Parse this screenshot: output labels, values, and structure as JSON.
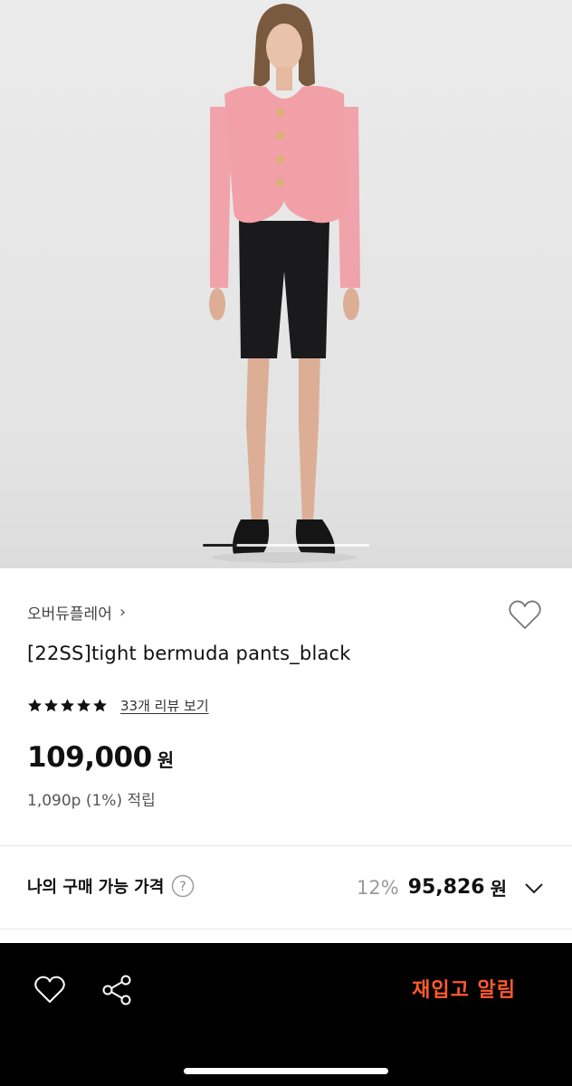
{
  "product": {
    "brand": "오버듀플레어",
    "brand_chevron": "›",
    "title": "[22SS]tight bermuda pants_black",
    "rating": 5,
    "review_link": "33개 리뷰 보기",
    "price": "109,000",
    "price_unit": "원",
    "points": "1,090p (1%) 적립"
  },
  "my_price": {
    "label": "나의 구매 가능 가격",
    "discount": "12%",
    "price": "95,826",
    "unit": "원"
  },
  "bottom_bar": {
    "restock_label": "재입고 알림"
  },
  "colors": {
    "accent": "#ff5a2c",
    "jacket": "#f2a0a8",
    "shorts": "#1a1a1d"
  },
  "icons": [
    "heart-icon",
    "help-icon",
    "chevron-down-icon",
    "share-icon",
    "star-icon"
  ]
}
